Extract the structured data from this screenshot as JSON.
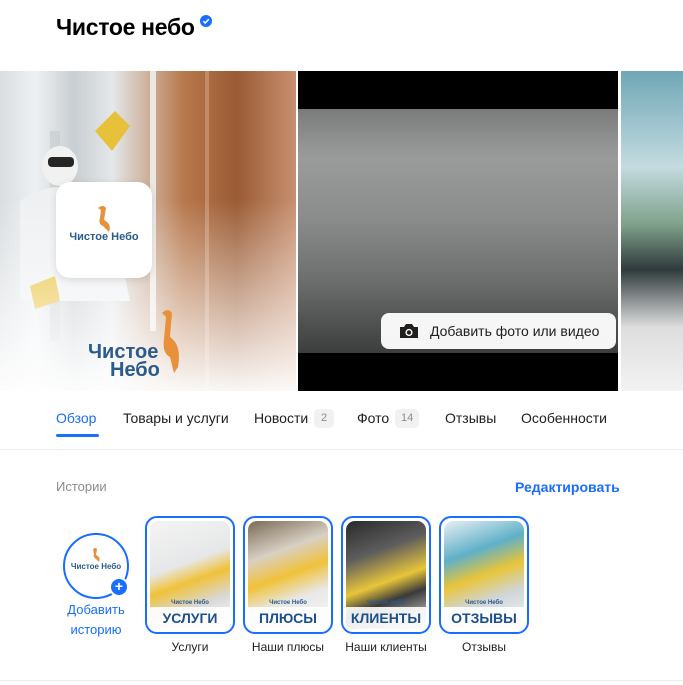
{
  "header": {
    "title": "Чистое небо"
  },
  "gallery": {
    "avatar_logo": "Чистое Небо",
    "photo_logo_line1": "Чистое",
    "photo_logo_line2": "Небо",
    "add_media_label": "Добавить фото или видео"
  },
  "tabs": [
    {
      "label": "Обзор",
      "active": true
    },
    {
      "label": "Товары и услуги"
    },
    {
      "label": "Новости",
      "badge": "2"
    },
    {
      "label": "Фото",
      "badge": "14"
    },
    {
      "label": "Отзывы"
    },
    {
      "label": "Особенности"
    }
  ],
  "stories": {
    "section_label": "Истории",
    "edit_label": "Редактировать",
    "add_logo": "Чистое Небо",
    "add_label_line1": "Добавить",
    "add_label_line2": "историю",
    "items": [
      {
        "brand": "Чистое Небо",
        "caption": "УСЛУГИ",
        "label": "Услуги"
      },
      {
        "brand": "Чистое Небо",
        "caption": "ПЛЮСЫ",
        "label": "Наши плюсы"
      },
      {
        "brand": "Чистое Небо",
        "caption": "КЛИЕНТЫ",
        "label": "Наши клиенты"
      },
      {
        "brand": "Чистое Небо",
        "caption": "ОТЗЫВЫ",
        "label": "Отзывы"
      }
    ]
  },
  "colors": {
    "accent": "#196dff",
    "brand_blue": "#2a5b8c",
    "brand_orange": "#e8913a"
  }
}
